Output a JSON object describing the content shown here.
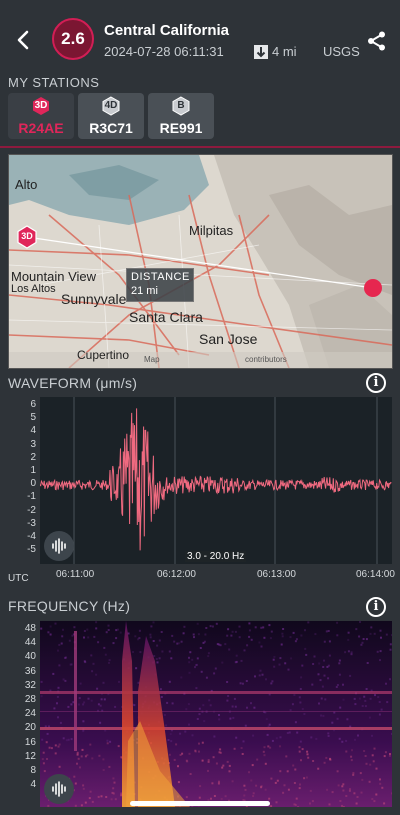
{
  "header": {
    "back_icon": "chevron-left-icon",
    "magnitude": "2.6",
    "title": "Central California",
    "datetime": "2024-07-28 06:11:31",
    "distance": "4 mi",
    "source": "USGS",
    "share_icon": "share-icon",
    "accent_color": "#d21e55"
  },
  "stations": {
    "label": "MY STATIONS",
    "items": [
      {
        "badge": "3D",
        "name": "R24AE",
        "active": true
      },
      {
        "badge": "4D",
        "name": "R3C71",
        "active": false
      },
      {
        "badge": "B",
        "name": "RE991",
        "active": false
      }
    ]
  },
  "map": {
    "places": [
      "Alto",
      "Milpitas",
      "Mountain View",
      "Los Altos",
      "Sunnyvale",
      "Santa Clara",
      "San Jose",
      "Cupertino"
    ],
    "station_marker": "3D",
    "distance_label": "DISTANCE",
    "distance_value": "21 mi",
    "attribution_left": "Map",
    "attribution_right": "contributors"
  },
  "waveform": {
    "title": "WAVEFORM (μm/s)",
    "y_ticks": [
      "6",
      "5",
      "4",
      "3",
      "2",
      "1",
      "0",
      "-1",
      "-2",
      "-3",
      "-4",
      "-5"
    ],
    "x_ticks": [
      "06:11:00",
      "06:12:00",
      "06:13:00",
      "06:14:00"
    ],
    "x_unit": "UTC",
    "filter": "3.0 - 20.0 Hz",
    "trace_color": "#f06a80"
  },
  "frequency": {
    "title": "FREQUENCY (Hz)",
    "y_ticks": [
      "48",
      "44",
      "40",
      "36",
      "32",
      "28",
      "24",
      "20",
      "16",
      "12",
      "8",
      "4"
    ]
  },
  "icons": {
    "info": "info-icon",
    "sound": "sound-wave-icon"
  }
}
